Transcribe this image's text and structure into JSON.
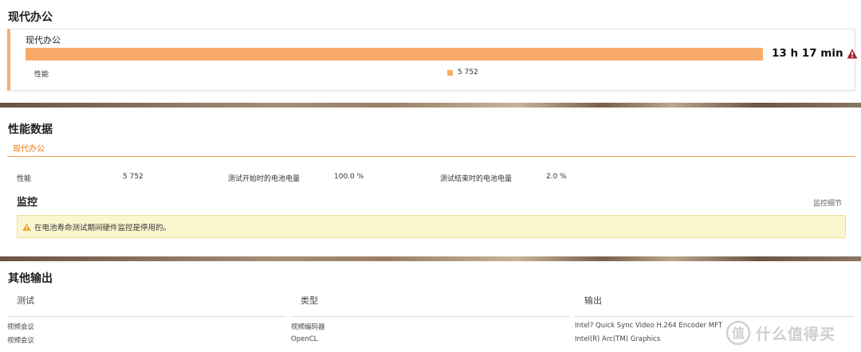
{
  "section1": {
    "title": "现代办公",
    "card": {
      "title": "现代办公",
      "bar_fraction": 1.0,
      "result": "13 h 17 min",
      "warning_icon": "warning-triangle-icon",
      "perf_label": "性能",
      "legend_value": "5 752",
      "accent_color": "#f8ab6a"
    }
  },
  "section2": {
    "title": "性能数据",
    "tab": "现代办公",
    "stats": [
      {
        "label": "性能",
        "value": "5 752"
      },
      {
        "label": "测试开始时的电池电量",
        "value": "100.0 %"
      },
      {
        "label": "测试结束时的电池电量",
        "value": "2.0 %"
      }
    ],
    "monitor": {
      "title": "监控",
      "details_link": "监控细节",
      "alert_text": "在电池寿命测试期间硬件监控是停用的。",
      "alert_icon": "warning-icon"
    }
  },
  "section3": {
    "title": "其他输出",
    "columns": [
      "测试",
      "类型",
      "输出"
    ],
    "rows": [
      [
        "视频会议",
        "视频编码器",
        "Intel? Quick Sync Video H.264 Encoder MFT"
      ],
      [
        "视频会议",
        "OpenCL",
        "Intel(R) Arc(TM) Graphics"
      ]
    ]
  },
  "watermark": {
    "text": "什么值得买",
    "icon": "zhi-logo-icon"
  }
}
